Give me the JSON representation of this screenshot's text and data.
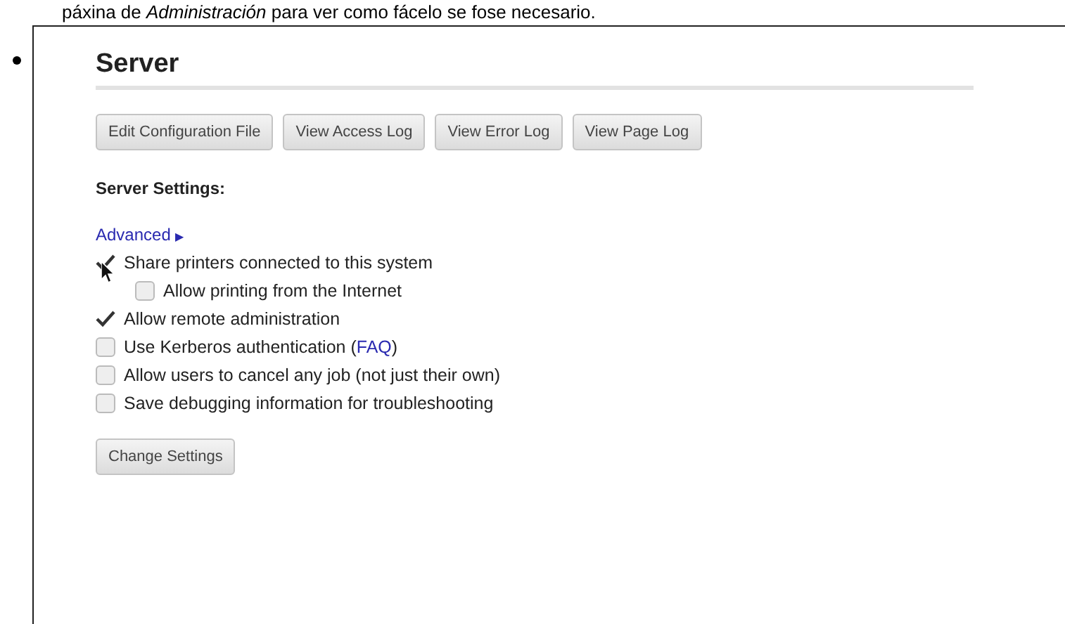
{
  "intro": "páxina de *Administración* para ver como fácelo se fose necesario.",
  "section": {
    "title": "Server",
    "buttons": [
      "Edit Configuration File",
      "View Access Log",
      "View Error Log",
      "View Page Log"
    ],
    "settings_heading": "Server Settings:",
    "advanced": {
      "label": "Advanced",
      "arrow": "▶"
    },
    "options": [
      {
        "text": "Share printers connected to this system",
        "checked": true,
        "children": [
          {
            "text": "Allow printing from the Internet",
            "checked": false
          }
        ]
      },
      {
        "text": "Allow remote administration",
        "checked": true
      },
      {
        "text": "Use Kerberos authentication (",
        "link": "FAQ",
        "text_after": ")",
        "checked": false
      },
      {
        "text": "Allow users to cancel any job (not just their own)",
        "checked": false
      },
      {
        "text": "Save debugging information for troubleshooting",
        "checked": false
      }
    ],
    "submit": "Change Settings"
  }
}
